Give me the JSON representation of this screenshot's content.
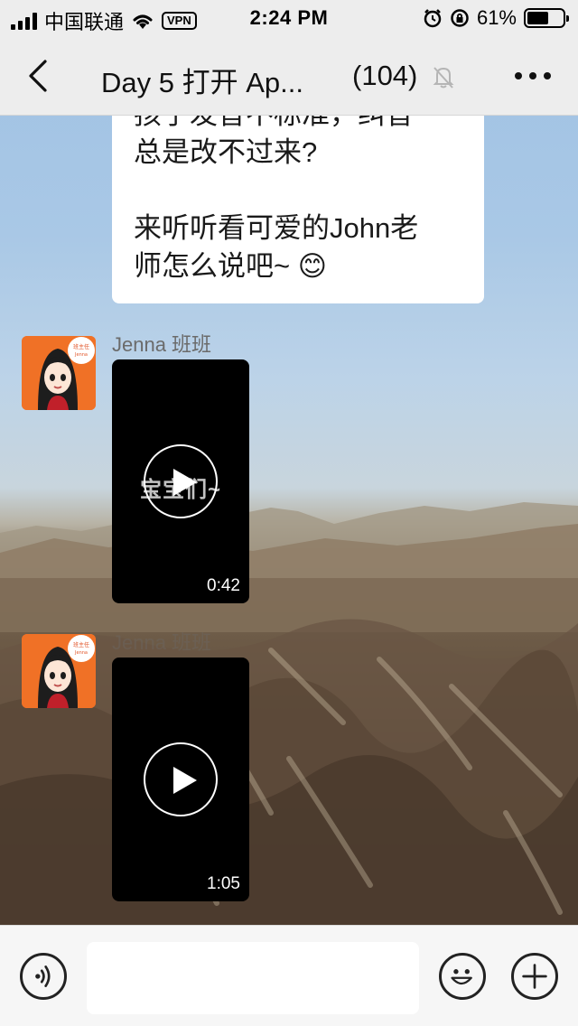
{
  "status_bar": {
    "carrier": "中国联通",
    "vpn": "VPN",
    "time": "2:24 PM",
    "battery_percent": "61%",
    "battery_level": 0.61
  },
  "header": {
    "title": "Day 5 打开 Ap...",
    "member_count": "(104)"
  },
  "chat": {
    "text_message": "孩子发音不标准，纠音\n总是改不过来?\n\n来听听看可爱的John老\n师怎么说吧~ 😊",
    "messages": [
      {
        "sender": "Jenna 班班",
        "avatar_badge": "班主任",
        "avatar_badge_name": "Jenna",
        "video_overlay_text": "宝宝们~",
        "duration": "0:42"
      },
      {
        "sender": "Jenna 班班",
        "avatar_badge": "班主任",
        "avatar_badge_name": "Jenna",
        "video_overlay_text": "",
        "duration": "1:05"
      }
    ]
  },
  "icons": {
    "back": "back-arrow-icon",
    "mute": "bell-muted-icon",
    "more": "more-dots-icon",
    "voice": "voice-icon",
    "emoji": "emoji-icon",
    "plus": "plus-icon"
  }
}
